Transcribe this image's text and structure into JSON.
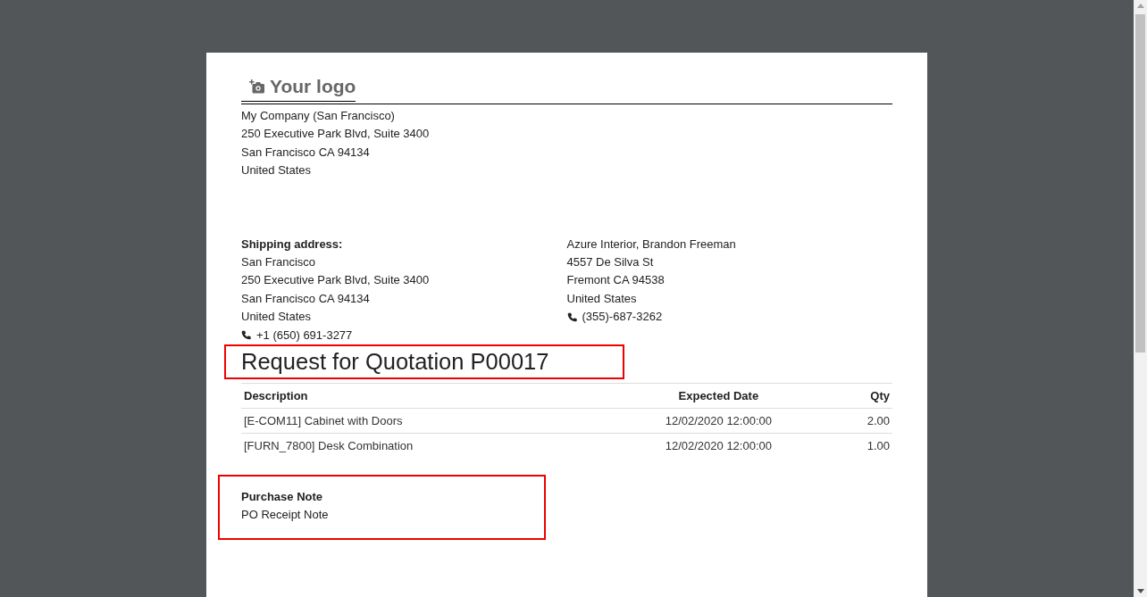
{
  "logo": {
    "text": "Your logo"
  },
  "company": [
    "My Company (San Francisco)",
    "250 Executive Park Blvd, Suite 3400",
    "San Francisco CA 94134",
    "United States"
  ],
  "shipping": {
    "heading": "Shipping address:",
    "lines": [
      "San Francisco",
      "250 Executive Park Blvd, Suite 3400",
      "San Francisco CA 94134",
      "United States"
    ],
    "phone": "+1 (650) 691-3277"
  },
  "vendor": {
    "lines": [
      "Azure Interior, Brandon Freeman",
      "4557 De Silva St",
      "Fremont CA 94538",
      "United States"
    ],
    "phone": "(355)-687-3262"
  },
  "title": {
    "text": "Request for Quotation P00017",
    "highlighted": true
  },
  "table": {
    "columns": [
      "Description",
      "Expected Date",
      "Qty"
    ],
    "rows": [
      [
        "[E-COM11] Cabinet with Doors",
        "12/02/2020 12:00:00",
        "2.00"
      ],
      [
        "[FURN_7800] Desk Combination",
        "12/02/2020 12:00:00",
        "1.00"
      ]
    ]
  },
  "note": {
    "heading": "Purchase Note",
    "text": "PO Receipt Note",
    "highlighted": true
  }
}
